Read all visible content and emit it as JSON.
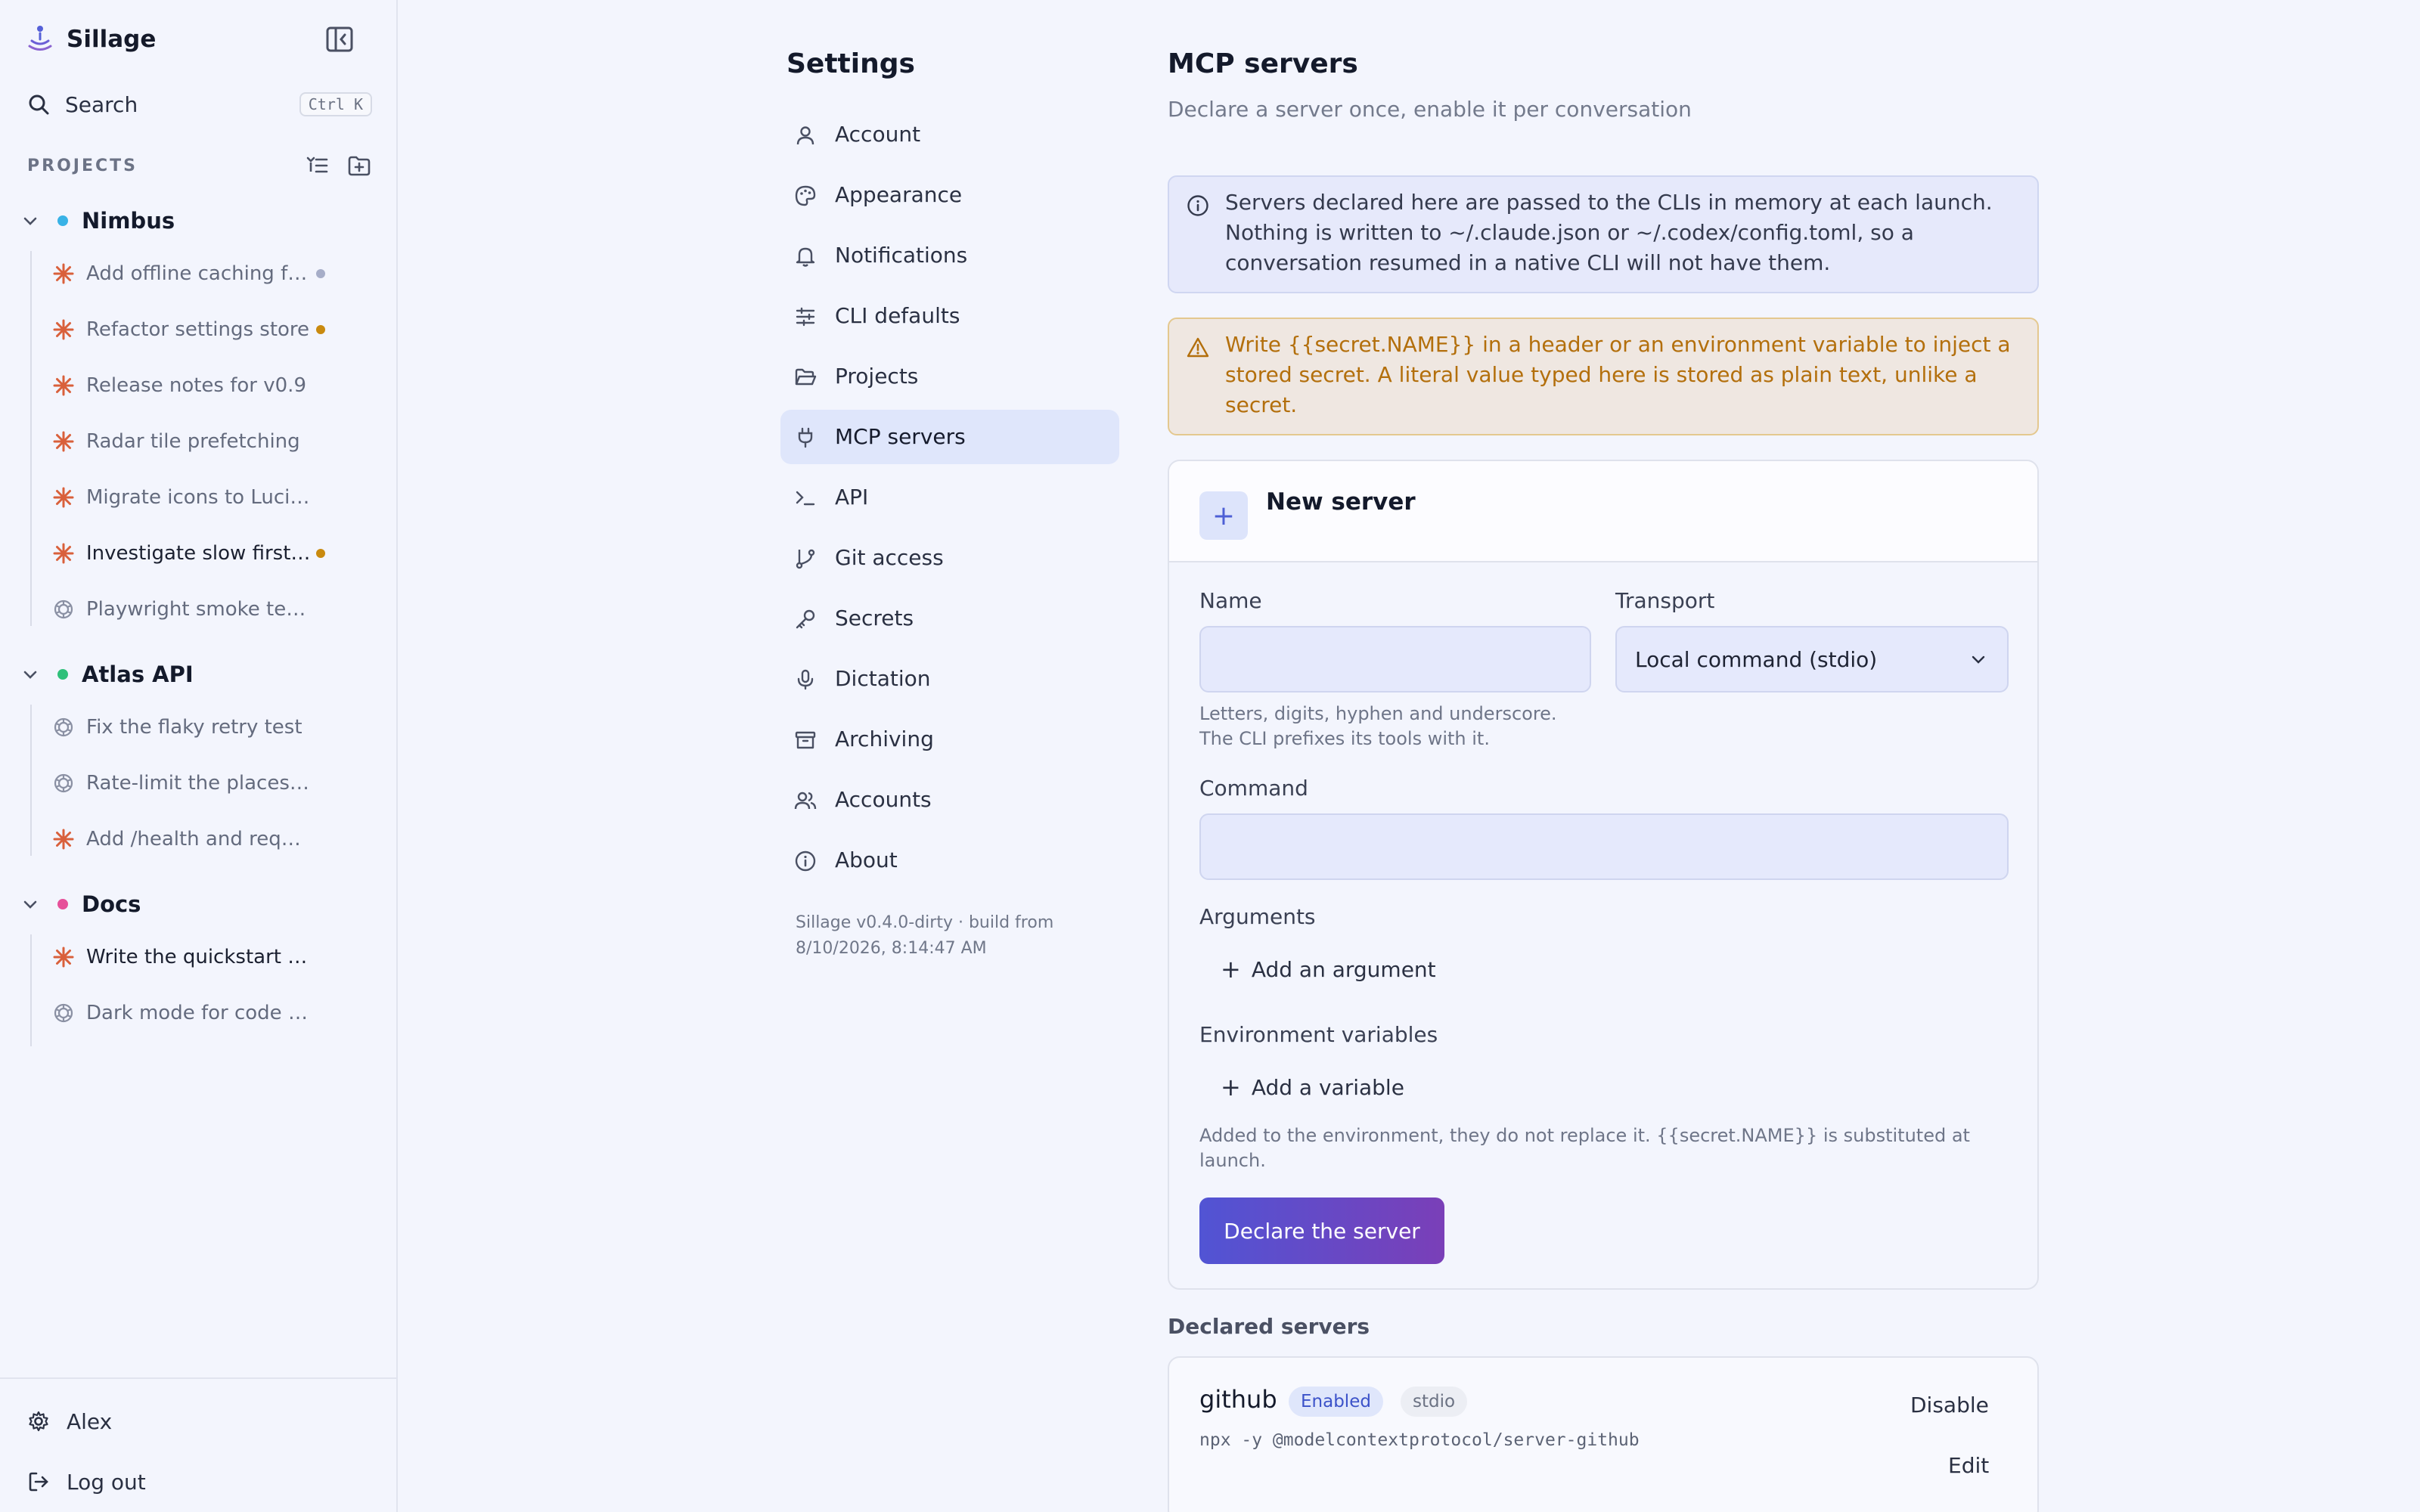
{
  "app": {
    "name": "Sillage"
  },
  "sidebar": {
    "search_label": "Search",
    "search_shortcut": "Ctrl K",
    "projects_heading": "PROJECTS",
    "groups": [
      {
        "name": "Nimbus",
        "color": "#38b2e6",
        "threads": [
          {
            "label": "Add offline caching for forecasts",
            "icon": "claude-spark-icon",
            "status": "#a6adc8"
          },
          {
            "label": "Refactor settings store",
            "icon": "claude-spark-icon",
            "status": "#c98a0f"
          },
          {
            "label": "Release notes for v0.9",
            "icon": "claude-spark-icon"
          },
          {
            "label": "Radar tile prefetching",
            "icon": "claude-spark-icon"
          },
          {
            "label": "Migrate icons to Lucide",
            "icon": "claude-spark-icon"
          },
          {
            "label": "Investigate slow first render",
            "icon": "claude-spark-icon",
            "status": "#c98a0f"
          },
          {
            "label": "Playwright smoke tests",
            "icon": "openai-knot-icon"
          }
        ]
      },
      {
        "name": "Atlas API",
        "color": "#2fc07a",
        "threads": [
          {
            "label": "Fix the flaky retry test",
            "icon": "openai-knot-icon"
          },
          {
            "label": "Rate-limit the places endpoint",
            "icon": "openai-knot-icon"
          },
          {
            "label": "Add /health and request logging",
            "icon": "claude-spark-icon"
          }
        ]
      },
      {
        "name": "Docs",
        "color": "#e6509a",
        "threads": [
          {
            "label": "Write the quickstart guide",
            "icon": "claude-spark-icon"
          },
          {
            "label": "Dark mode for code blocks",
            "icon": "openai-knot-icon"
          }
        ]
      }
    ],
    "user_name": "Alex",
    "logout_label": "Log out"
  },
  "settings": {
    "title": "Settings",
    "nav": [
      {
        "label": "Account",
        "icon": "user-icon"
      },
      {
        "label": "Appearance",
        "icon": "palette-icon"
      },
      {
        "label": "Notifications",
        "icon": "bell-icon"
      },
      {
        "label": "CLI defaults",
        "icon": "sliders-icon"
      },
      {
        "label": "Projects",
        "icon": "folder-open-icon"
      },
      {
        "label": "MCP servers",
        "icon": "plug-icon",
        "active": true
      },
      {
        "label": "API",
        "icon": "terminal-icon"
      },
      {
        "label": "Git access",
        "icon": "git-branch-icon"
      },
      {
        "label": "Secrets",
        "icon": "key-icon"
      },
      {
        "label": "Dictation",
        "icon": "mic-icon"
      },
      {
        "label": "Archiving",
        "icon": "archive-icon"
      },
      {
        "label": "Accounts",
        "icon": "users-icon"
      },
      {
        "label": "About",
        "icon": "info-icon"
      }
    ],
    "version_line1": "Sillage v0.4.0-dirty · build from",
    "version_line2": "8/10/2026, 8:14:47 AM"
  },
  "main": {
    "title": "MCP servers",
    "subtitle": "Declare a server once, enable it per conversation",
    "info_text": "Servers declared here are passed to the CLIs in memory at each launch. Nothing is written to ~/.claude.json or ~/.codex/config.toml, so a conversation resumed in a native CLI will not have them.",
    "warning_text": "Write {{secret.NAME}} in a header or an environment variable to inject a stored secret. A literal value typed here is stored as plain text, unlike a secret.",
    "new_server": {
      "title": "New server",
      "name_label": "Name",
      "name_value": "",
      "name_hint_line1": "Letters, digits, hyphen and underscore.",
      "name_hint_line2": "The CLI prefixes its tools with it.",
      "transport_label": "Transport",
      "transport_value": "Local command (stdio)",
      "command_label": "Command",
      "command_value": "",
      "arguments_label": "Arguments",
      "add_argument_label": "Add an argument",
      "env_label": "Environment variables",
      "add_variable_label": "Add a variable",
      "env_hint": "Added to the environment, they do not replace it. {{secret.NAME}} is substituted at launch.",
      "submit_label": "Declare the server"
    },
    "declared_heading": "Declared servers",
    "declared": [
      {
        "name": "github",
        "status": "Enabled",
        "transport": "stdio",
        "command": "npx -y @modelcontextprotocol/server-github",
        "disable_label": "Disable",
        "edit_label": "Edit"
      }
    ]
  }
}
